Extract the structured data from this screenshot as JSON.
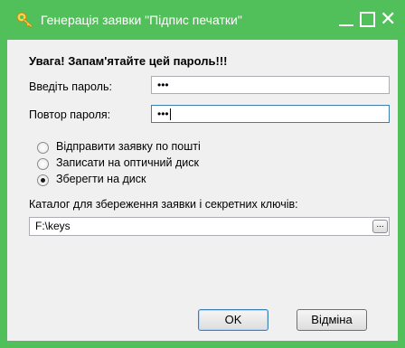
{
  "window": {
    "title": "Генерація заявки \"Підпис печатки\"",
    "minimize_icon": "minimize-icon",
    "maximize_icon": "maximize-icon",
    "close_glyph": "✕"
  },
  "form": {
    "warning": "Увага! Запам'ятайте цей пароль!!!",
    "password_label": "Введіть пароль:",
    "password_value": "•••",
    "repeat_label": "Повтор пароля:",
    "repeat_value": "•••",
    "options": [
      {
        "label": "Відправити заявку  по пошті",
        "checked": false
      },
      {
        "label": "Записати на оптичний диск",
        "checked": false
      },
      {
        "label": "Зберегти на диск",
        "checked": true
      }
    ],
    "catalog_label": "Каталог для збереження заявки і секретних ключів:",
    "catalog_value": "F:\\keys",
    "browse_label": "..."
  },
  "buttons": {
    "ok_label": "OK",
    "cancel_label": "Відміна"
  },
  "colors": {
    "frame": "#52c05a",
    "client": "#f0f0f0"
  }
}
